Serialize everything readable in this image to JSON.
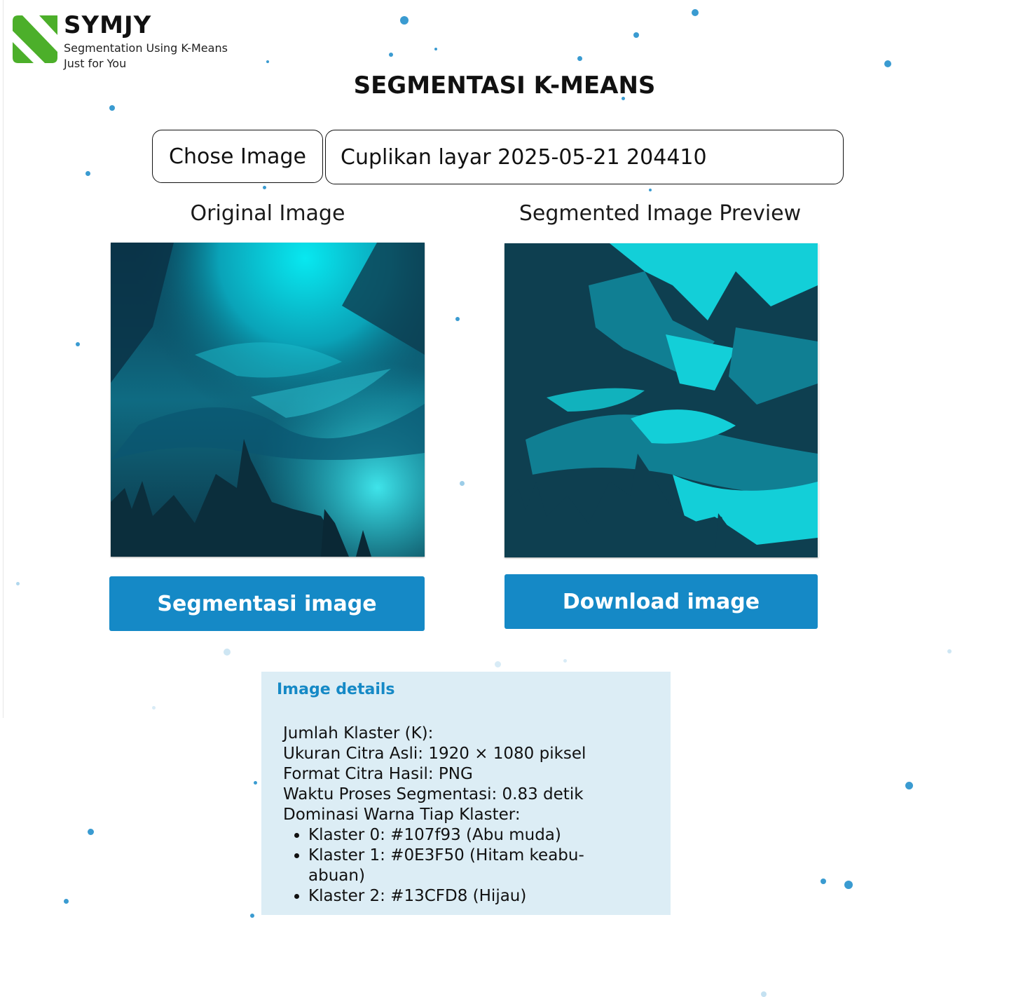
{
  "brand": {
    "name": "SYMJY",
    "tagline_line1": "Segmentation Using K-Means",
    "tagline_line2": "Just for You",
    "logo_color": "#4caf2a"
  },
  "page": {
    "title": "SEGMENTASI K-MEANS"
  },
  "file_chooser": {
    "button_label": "Chose Image",
    "filename": "Cuplikan layar 2025-05-21 204410"
  },
  "original": {
    "heading": "Original Image",
    "action_label": "Segmentasi image"
  },
  "segmented": {
    "heading": "Segmented Image Preview",
    "action_label": "Download image"
  },
  "details": {
    "title": "Image details",
    "k_label": "Jumlah Klaster (K):",
    "size": "Ukuran Citra Asli: 1920 × 1080 piksel",
    "format": "Format Citra Hasil: PNG",
    "time": "Waktu Proses Segmentasi: 0.83 detik",
    "dominance_label": "Dominasi Warna Tiap Klaster:",
    "clusters": [
      "Klaster 0: #107f93 (Abu muda)",
      "Klaster 1: #0E3F50 (Hitam keabu-abuan)",
      "Klaster 2: #13CFD8 (Hijau)"
    ]
  },
  "colors": {
    "accent": "#1589c6",
    "details_bg": "#dcedf5",
    "dot": "#3a9bd1",
    "cluster_0": "#107f93",
    "cluster_1": "#0E3F50",
    "cluster_2": "#13CFD8"
  }
}
